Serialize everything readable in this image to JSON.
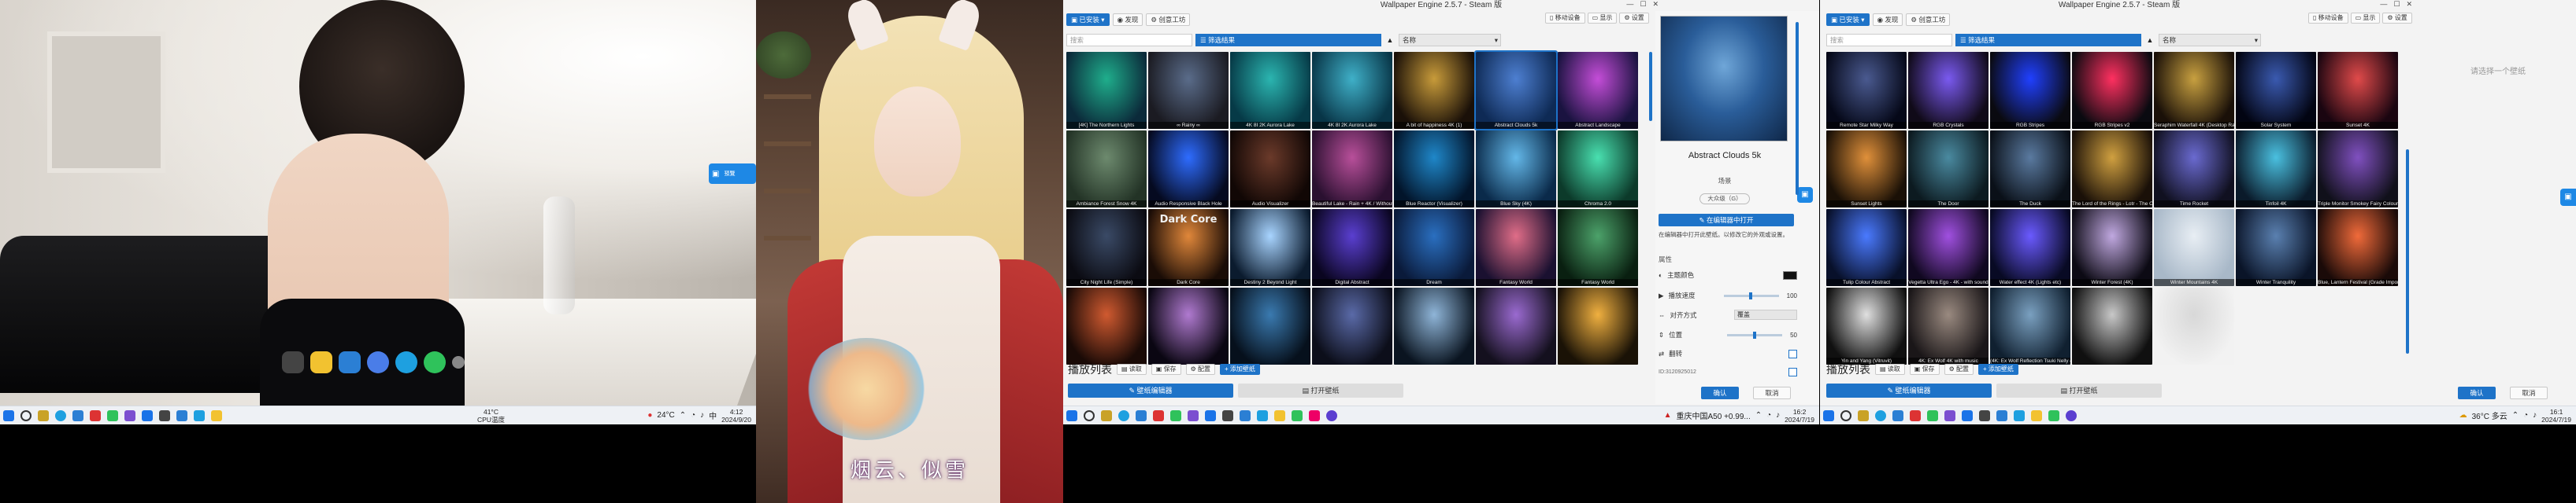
{
  "monitor1": {
    "float_tab_label": "預覽",
    "taskbar": {
      "weather_temp": "24°C",
      "weather_line1": "41°C",
      "weather_line2": "CPU温度",
      "lang": "中",
      "time": "4:12",
      "date": "2024/9/20"
    }
  },
  "monitor2": {
    "caption": "烟云、似雪"
  },
  "we_left": {
    "title": "Wallpaper Engine 2.5.7 - Steam 版",
    "tabs": [
      "已安装",
      "发现",
      "创意工坊"
    ],
    "right_tools": [
      "移动设备",
      "显示",
      "设置"
    ],
    "search_placeholder": "搜索",
    "filter_label": "筛选结果",
    "sort_label": "名称",
    "tiles": [
      "[4K] The Northern Lights",
      "∞ Rainy ∞",
      "4K 8I 2K Aurora Lake",
      "4K 8I 2K Aurora Lake",
      "A bit of happiness 4K (1)",
      "Abstract Clouds 5k",
      "Abstract Landscape",
      "Ambiance Forest Snow 4K",
      "Audio Responsive Black Hole",
      "Audio Visualizer",
      "Beautiful Lake - Rain + 4K / Without Sound",
      "Blue Reactor (Visualizer)",
      "Blue Sky (4K)",
      "Chroma 2.0",
      "City Night Life (Simple)",
      "Dark Core",
      "Destiny 2 Beyond Light",
      "Digital Abstract",
      "Dream",
      "Fantasy World",
      "Fantasy World",
      "",
      "",
      "",
      "",
      "",
      "",
      ""
    ],
    "dark_core_label": "Dark Core",
    "preview": {
      "title": "Abstract Clouds 5k",
      "subtitle": "场景",
      "tag": "大众级（G）",
      "open_button": "在编辑器中打开",
      "desc": "在编辑器中打开此壁纸。以修改它的外观或设置。",
      "props_header": "属性",
      "props": [
        {
          "label": "主题颜色",
          "value": ""
        },
        {
          "label": "播放速度",
          "value": "100"
        },
        {
          "label": "对齐方式",
          "value": "覆盖"
        },
        {
          "label": "位置",
          "value": "50"
        },
        {
          "label": "翻转",
          "value": ""
        },
        {
          "label": "",
          "value": ""
        }
      ],
      "id_text": "ID:3120925012"
    },
    "playlist_label": "播放列表",
    "playlist_buttons": [
      "读取",
      "保存",
      "配置",
      "添加壁纸"
    ],
    "bottom_left": "壁纸编辑器",
    "bottom_mid": "打开壁纸",
    "ok": "确认",
    "cancel": "取消"
  },
  "monitor3_taskbar": {
    "weather": "重庆中国A50 +0.99...",
    "time": "16:2",
    "date": "2024/7/19"
  },
  "we_right": {
    "title": "Wallpaper Engine 2.5.7 - Steam 版",
    "tabs": [
      "已安装",
      "发现",
      "创意工坊"
    ],
    "right_tools": [
      "移动设备",
      "显示",
      "设置"
    ],
    "search_placeholder": "搜索",
    "filter_label": "筛选结果",
    "sort_label": "名称",
    "tiles": [
      "Remote Star Milky Way",
      "RGB Crystals",
      "RGB Stripes",
      "RGB Stripes v2",
      "Seraphim Waterfall 4K (Desktop Ratio)",
      "Solar System",
      "Sunset 4K",
      "Sunset Lights",
      "The Door",
      "The Duck",
      "The Lord of the Rings - Lotr - The One Ring 4K (Real 4K)",
      "Time Rocket",
      "Tinfoil 4K",
      "Triple Monitor Smokey Fairy Colour",
      "Tulip Colour Abstract",
      "Vegetta Ultra Ego - 4K - with sound",
      "Water effect 4K (Lights etc)",
      "Winter Forest (4K)",
      "Winter Mountains 4K",
      "Winter Tranquility",
      "Blue, Lantern Festival (Grade Import)",
      "Yin and Yang (Vitruvit)",
      "4K: Ex Wolf 4K with music",
      "(4K: Ex Wolf Reflection Tsuki Nelly 4K.. (Live...)",
      "",
      "",
      "",
      ""
    ],
    "placeholder_text": "请选择一个壁纸",
    "playlist_label": "播放列表",
    "playlist_buttons": [
      "读取",
      "保存",
      "配置",
      "添加壁纸"
    ],
    "bottom_left": "壁纸编辑器",
    "bottom_mid": "打开壁纸",
    "ok": "确认",
    "cancel": "取消"
  },
  "monitor4_taskbar": {
    "weather": "36°C 多云",
    "time": "16:1",
    "date": "2024/7/19"
  }
}
